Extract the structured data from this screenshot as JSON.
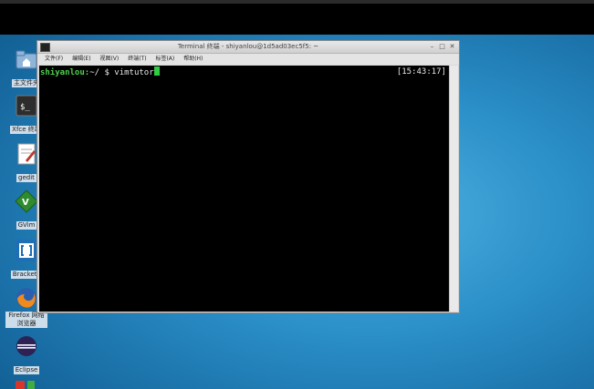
{
  "desktop": {
    "icons": [
      {
        "label": "主文件夹",
        "icon": "home-folder-icon"
      },
      {
        "label": "Xfce 终端",
        "icon": "terminal-icon"
      },
      {
        "label": "gedit",
        "icon": "gedit-icon"
      },
      {
        "label": "GVim",
        "icon": "gvim-icon"
      },
      {
        "label": "Brackets",
        "icon": "brackets-icon"
      },
      {
        "label": "Firefox 网络浏览器",
        "icon": "firefox-icon"
      },
      {
        "label": "Eclipse",
        "icon": "eclipse-icon"
      }
    ]
  },
  "terminal": {
    "title": "Terminal 终端 - shiyanlou@1d5ad03ec5f5: ~",
    "menu": [
      "文件(F)",
      "编辑(E)",
      "视图(V)",
      "终端(T)",
      "标签(A)",
      "帮助(H)"
    ],
    "prompt_user": "shiyanlou:",
    "prompt_rest": "~/ $ vimtutor",
    "clock": "[15:43:17]"
  },
  "colors": {
    "prompt": "#4fd34f",
    "cursor": "#2ecc40",
    "terminal_bg": "#000000"
  }
}
